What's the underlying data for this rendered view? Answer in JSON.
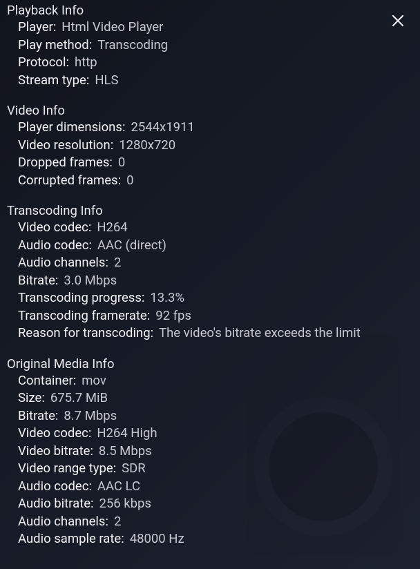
{
  "playback_info": {
    "title": "Playback Info",
    "player": {
      "label": "Player",
      "value": "Html Video Player"
    },
    "play_method": {
      "label": "Play method",
      "value": "Transcoding"
    },
    "protocol": {
      "label": "Protocol",
      "value": "http"
    },
    "stream_type": {
      "label": "Stream type",
      "value": "HLS"
    }
  },
  "video_info": {
    "title": "Video Info",
    "player_dimensions": {
      "label": "Player dimensions",
      "value": "2544x1911"
    },
    "video_resolution": {
      "label": "Video resolution",
      "value": "1280x720"
    },
    "dropped_frames": {
      "label": "Dropped frames",
      "value": "0"
    },
    "corrupted_frames": {
      "label": "Corrupted frames",
      "value": "0"
    }
  },
  "transcoding_info": {
    "title": "Transcoding Info",
    "video_codec": {
      "label": "Video codec",
      "value": "H264"
    },
    "audio_codec": {
      "label": "Audio codec",
      "value": "AAC (direct)"
    },
    "audio_channels": {
      "label": "Audio channels",
      "value": "2"
    },
    "bitrate": {
      "label": "Bitrate",
      "value": "3.0 Mbps"
    },
    "transcoding_progress": {
      "label": "Transcoding progress",
      "value": "13.3%"
    },
    "transcoding_framerate": {
      "label": "Transcoding framerate",
      "value": "92 fps"
    },
    "reason": {
      "label": "Reason for transcoding",
      "value": "The video's bitrate exceeds the limit"
    }
  },
  "original_media_info": {
    "title": "Original Media Info",
    "container": {
      "label": "Container",
      "value": "mov"
    },
    "size": {
      "label": "Size",
      "value": "675.7 MiB"
    },
    "bitrate": {
      "label": "Bitrate",
      "value": "8.7 Mbps"
    },
    "video_codec": {
      "label": "Video codec",
      "value": "H264 High"
    },
    "video_bitrate": {
      "label": "Video bitrate",
      "value": "8.5 Mbps"
    },
    "video_range_type": {
      "label": "Video range type",
      "value": "SDR"
    },
    "audio_codec": {
      "label": "Audio codec",
      "value": "AAC LC"
    },
    "audio_bitrate": {
      "label": "Audio bitrate",
      "value": "256 kbps"
    },
    "audio_channels": {
      "label": "Audio channels",
      "value": "2"
    },
    "audio_sample_rate": {
      "label": "Audio sample rate",
      "value": "48000 Hz"
    }
  }
}
